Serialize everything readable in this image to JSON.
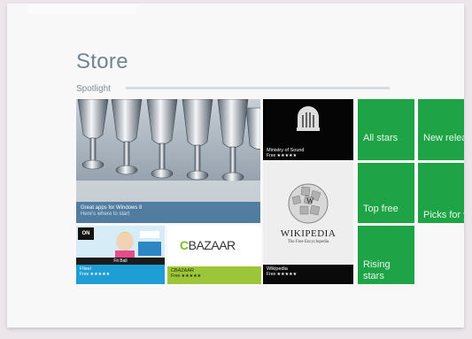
{
  "header": {
    "title": "Store",
    "section": "Spotlight"
  },
  "hero": {
    "line1": "Great apps for Windows 8",
    "line2": "Here's where to start"
  },
  "tiles": {
    "ministry": {
      "name": "Ministry of Sound",
      "price": "Free ★★★★★"
    },
    "wikipedia": {
      "logo_title": "WIKIPEDIA",
      "logo_subtitle": "The Free Encyclopedia",
      "name": "Wikipedia",
      "price": "Free ★★★★★"
    },
    "flixel": {
      "badge": "ON",
      "banner": "Fit Ball",
      "name": "Flixel",
      "price": "Free ★★★★★"
    },
    "cbazaar": {
      "logo_c": "C",
      "logo_rest": "BAZAAR",
      "name": "CBAZAAR",
      "price": "Free ★★★★★"
    }
  },
  "categories": [
    {
      "label": "All stars"
    },
    {
      "label": "New releases"
    },
    {
      "label": "Top free"
    },
    {
      "label": "Picks for you"
    },
    {
      "label": "Rising stars"
    }
  ],
  "colors": {
    "accent_green": "#1ea446",
    "title_blue": "#6f8592"
  }
}
